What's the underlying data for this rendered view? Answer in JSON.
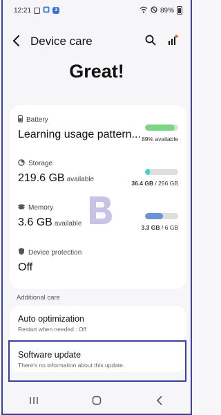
{
  "status_bar": {
    "time": "12:21",
    "battery_percent": "89%",
    "notification_badge": "3"
  },
  "app_bar": {
    "title": "Device care",
    "back_icon": "back-arrow-icon",
    "search_icon": "search-icon",
    "stats_icon": "bar-chart-icon"
  },
  "headline": "Great!",
  "status_card": {
    "battery": {
      "label": "Battery",
      "value": "Learning usage pattern...",
      "note": "89% available",
      "level": 0.89,
      "color": "#7ed58a"
    },
    "storage": {
      "label": "Storage",
      "value": "219.6 GB",
      "unit": "available",
      "note_used": "36.4 GB",
      "note_total": " / 256 GB",
      "level": 0.142,
      "color": "#4fcfbe"
    },
    "memory": {
      "label": "Memory",
      "value": "3.6 GB",
      "unit": "available",
      "note_used": "3.3 GB",
      "note_total": " / 6 GB",
      "level": 0.55,
      "color": "#6a93d8"
    },
    "protection": {
      "label": "Device protection",
      "value": "Off"
    }
  },
  "additional_care": {
    "section_title": "Additional care",
    "items": [
      {
        "title": "Auto optimization",
        "subtitle": "Restart when needed : Off"
      },
      {
        "title": "Software update",
        "subtitle": "There's no information about this update."
      }
    ]
  },
  "nav_bar": {
    "recents_icon": "recents-icon",
    "home_icon": "home-icon",
    "back_icon": "back-chevron-icon"
  }
}
